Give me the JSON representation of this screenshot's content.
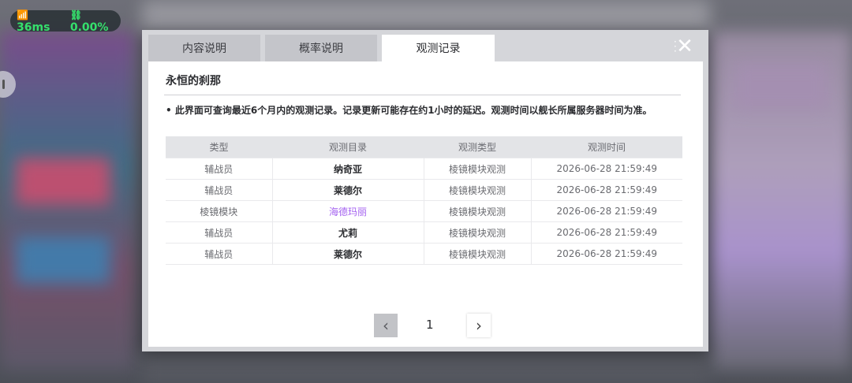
{
  "status": {
    "ping": "36ms",
    "loss": "0.00%"
  },
  "tabs": [
    {
      "label": "内容说明",
      "active": false
    },
    {
      "label": "概率说明",
      "active": false
    },
    {
      "label": "观测记录",
      "active": true
    }
  ],
  "panel": {
    "title": "永恒的刹那",
    "notice": "• 此界面可查询最近6个月内的观测记录。记录更新可能存在约1小时的延迟。观测时间以舰长所属服务器时间为准。"
  },
  "table": {
    "headers": [
      "类型",
      "观测目录",
      "观测类型",
      "观测时间"
    ],
    "rows": [
      [
        "辅战员",
        "纳奇亚",
        "棱镜模块观测",
        "2026-06-28 21:59:49"
      ],
      [
        "辅战员",
        "莱德尔",
        "棱镜模块观测",
        "2026-06-28 21:59:49"
      ],
      [
        "棱镜模块",
        "海德玛丽",
        "棱镜模块观测",
        "2026-06-28 21:59:49"
      ],
      [
        "辅战员",
        "尤莉",
        "棱镜模块观测",
        "2026-06-28 21:59:49"
      ],
      [
        "辅战员",
        "莱德尔",
        "棱镜模块观测",
        "2026-06-28 21:59:49"
      ]
    ]
  },
  "pagination": {
    "current": "1"
  },
  "icons": {
    "wifi": "wifi-icon",
    "loss": "link-broken-icon",
    "close": "close-icon",
    "prev": "chevron-left-icon",
    "next": "chevron-right-icon"
  },
  "colors": {
    "highlight": "#a462f0",
    "netGreen": "#35e06c"
  }
}
